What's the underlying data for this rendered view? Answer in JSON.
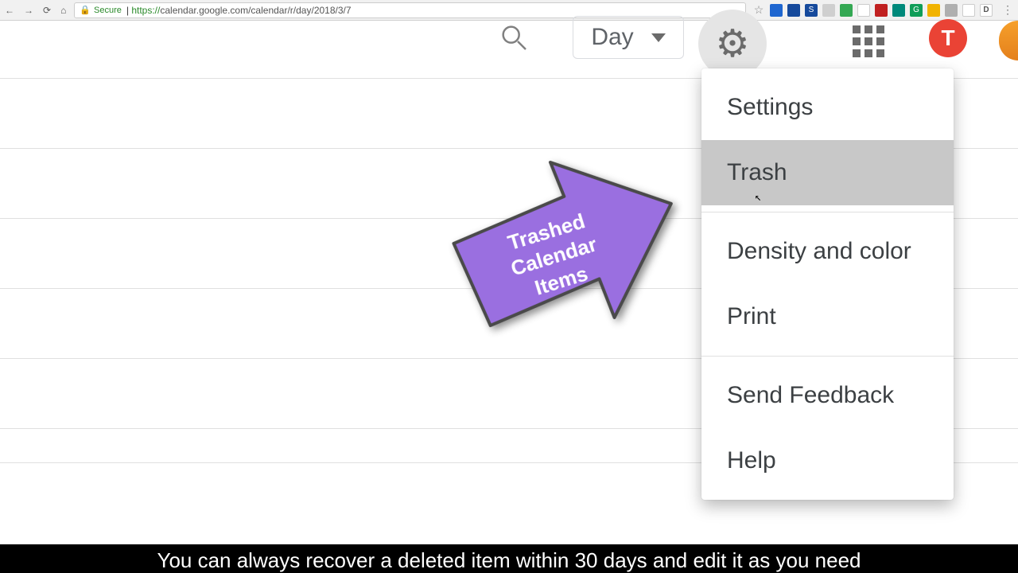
{
  "browser": {
    "secure_label": "Secure",
    "url_proto": "https://",
    "url_rest": "calendar.google.com/calendar/r/day/2018/3/7",
    "ext_letter": "D"
  },
  "toolbar": {
    "view_label": "Day",
    "avatar_letter": "T"
  },
  "dropdown": {
    "items": [
      {
        "label": "Settings"
      },
      {
        "label": "Trash"
      },
      {
        "label": "Density and color"
      },
      {
        "label": "Print"
      },
      {
        "label": "Send Feedback"
      },
      {
        "label": "Help"
      }
    ]
  },
  "annotation": {
    "line1": "Trashed",
    "line2": "Calendar",
    "line3": "Items",
    "fill": "#9a6fe0",
    "stroke": "#4a4a4a"
  },
  "caption": {
    "text": "You can always recover a deleted item within 30 days and edit it as you need"
  }
}
